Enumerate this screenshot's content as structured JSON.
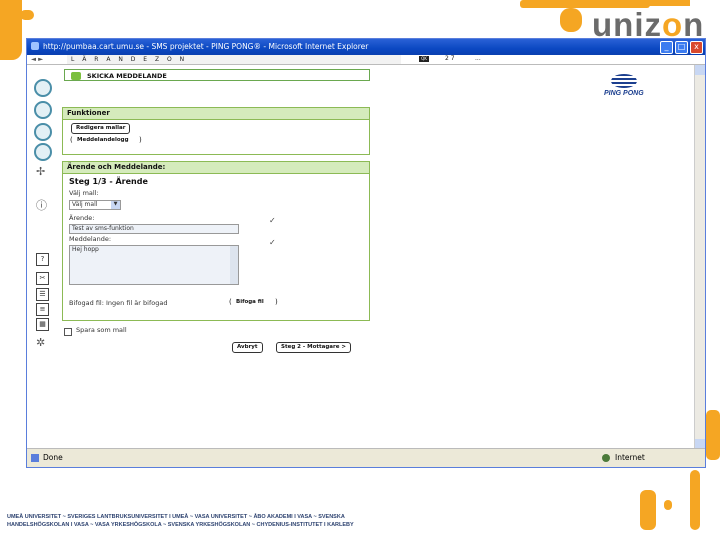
{
  "brand": {
    "prefix": "uniz",
    "o": "o",
    "suffix": "n"
  },
  "window": {
    "title": "http://pumbaa.cart.umu.se - SMS projektet - PING PONG® - Microsoft Internet Explorer",
    "min": "_",
    "max": "□",
    "close": "x"
  },
  "navbar": {
    "back": "◄ ►",
    "banner": "L Ä R A N D E Z O N",
    "tag": "QK",
    "page": "2 7",
    "dots": "..."
  },
  "page": {
    "header": "SKICKA MEDDELANDE",
    "funktioner": {
      "title": "Funktioner",
      "edit_button": "Redigera mallar",
      "log_open": "(",
      "log_link": "Meddelandelogg",
      "log_close": ")"
    },
    "arende": {
      "title": "Ärende och Meddelande:",
      "step": "Steg 1/3 - Ärende",
      "template_label": "Välj mall:",
      "template_value": "Välj mall",
      "subject_label": "Ärende:",
      "subject_value": "Test av sms-funktion",
      "message_label": "Meddelande:",
      "message_value": "Hej hopp",
      "attachment_label": "Bifogad fil: Ingen fil är bifogad",
      "attach_open": "(",
      "attach_link": "Bifoga fil",
      "attach_close": ")"
    },
    "save_as_template": "Spara som mall",
    "cancel_button": "Avbryt",
    "next_button": "Steg 2 - Mottagare >"
  },
  "pingpong": "PING PONG",
  "status": {
    "left": "Done",
    "right": "Internet"
  },
  "footer": {
    "line1": "UMEÅ UNIVERSITET ~ SVERIGES LANTBRUKSUNIVERSITET I UMEÅ ~ VASA UNIVERSITET ~ ÅBO AKADEMI I VASA ~ SVENSKA",
    "line2": "HANDELSHÖGSKOLAN I VASA ~ VASA YRKESHÖGSKOLA ~ SVENSKA YRKESHÖGSKOLAN ~ CHYDENIUS-INSTITUTET I KARLEBY"
  }
}
